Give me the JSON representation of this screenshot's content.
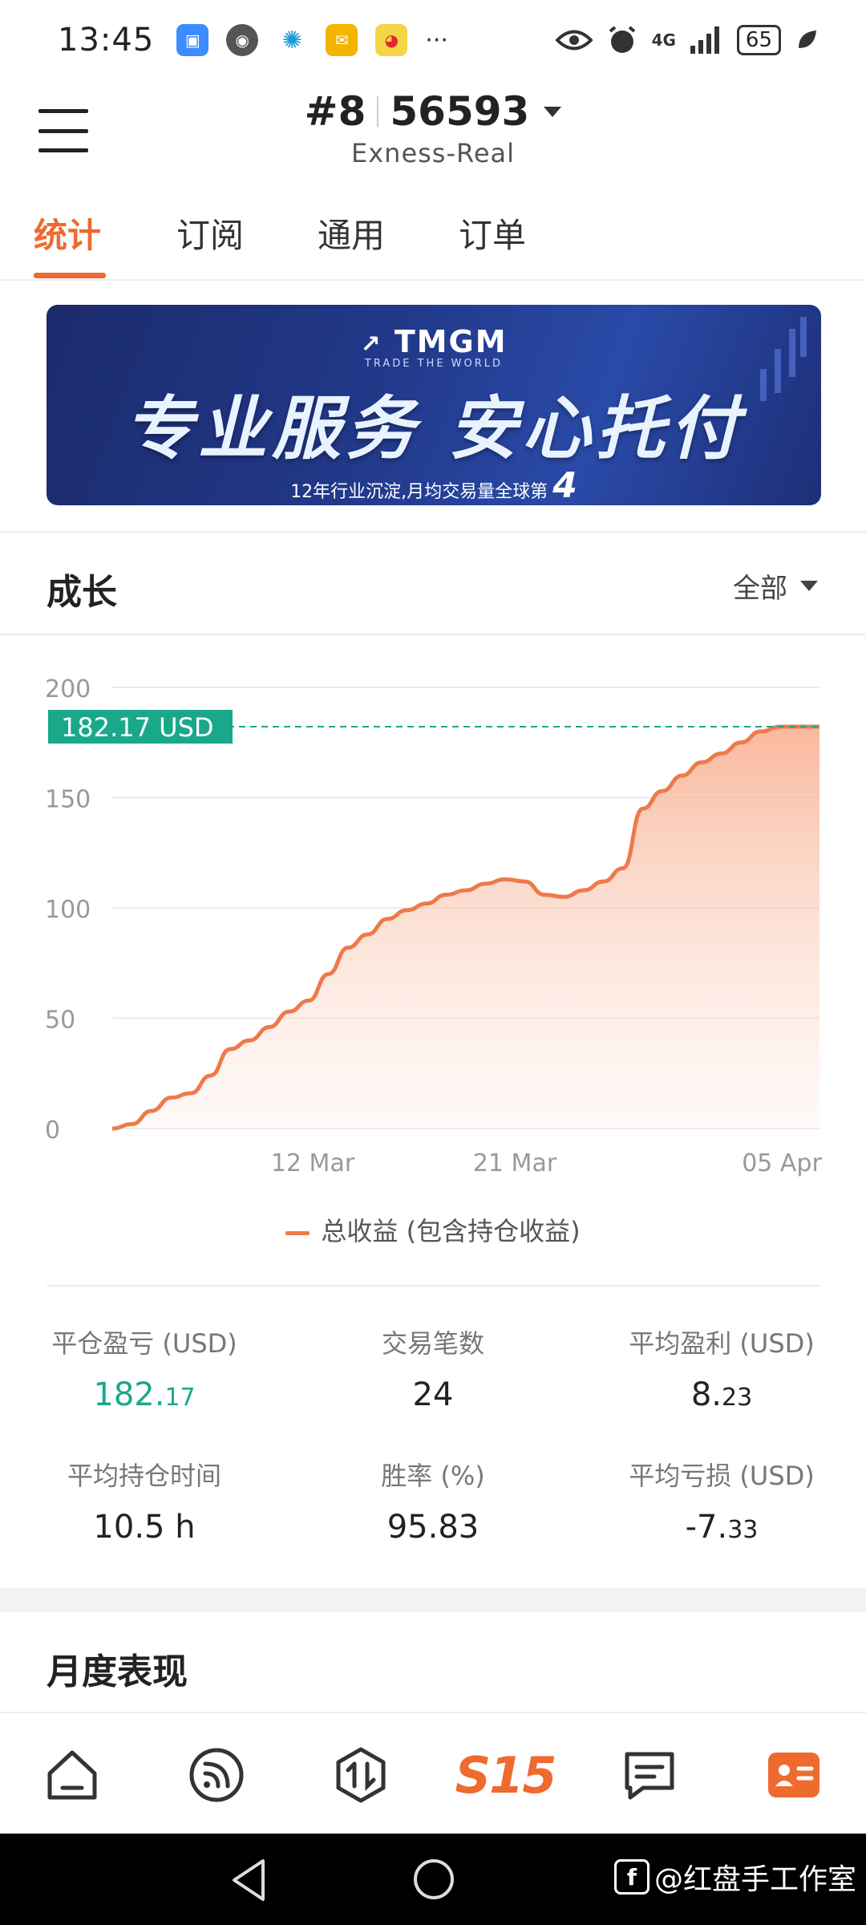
{
  "status_bar": {
    "time": "13:45",
    "network": "4G",
    "battery": "65",
    "more": "···"
  },
  "header": {
    "account_prefix": "#8",
    "account_number": "56593",
    "server": "Exness-Real"
  },
  "tabs": [
    {
      "label": "统计",
      "active": true
    },
    {
      "label": "订阅",
      "active": false
    },
    {
      "label": "通用",
      "active": false
    },
    {
      "label": "订单",
      "active": false
    }
  ],
  "banner": {
    "logo": "TMGM",
    "tagline": "TRADE THE WORLD",
    "title": "专业服务 安心托付",
    "footer_text": "12年行业沉淀,月均交易量全球第",
    "footer_rank": "4"
  },
  "growth": {
    "title": "成长",
    "filter": "全部"
  },
  "chart_data": {
    "type": "area",
    "y_ticks": [
      "200",
      "150",
      "100",
      "50",
      "0"
    ],
    "ylim": [
      0,
      200
    ],
    "x_ticks": [
      "12 Mar",
      "21 Mar",
      "05 Apr"
    ],
    "current_label": "182.17 USD",
    "current_value": 182.17,
    "grid": true,
    "series": [
      {
        "name": "总收益 (包含持仓收益)",
        "color": "#ee7a4a",
        "values": [
          0,
          2,
          8,
          14,
          16,
          24,
          36,
          40,
          46,
          53,
          58,
          70,
          82,
          88,
          95,
          99,
          102,
          106,
          108,
          111,
          113,
          112,
          106,
          105,
          108,
          112,
          118,
          145,
          153,
          160,
          166,
          170,
          175,
          180,
          182.17,
          182.17,
          182.17
        ]
      }
    ]
  },
  "stats": {
    "closed_pnl": {
      "label": "平仓盈亏 (USD)",
      "int": "182.",
      "frac": "17"
    },
    "trades": {
      "label": "交易笔数",
      "value": "24"
    },
    "avg_profit": {
      "label": "平均盈利 (USD)",
      "int": "8.",
      "frac": "23"
    },
    "avg_hold": {
      "label": "平均持仓时间",
      "value": "10.5 h"
    },
    "win_rate": {
      "label": "胜率 (%)",
      "value": "95.83"
    },
    "avg_loss": {
      "label": "平均亏损 (USD)",
      "int": "-7.",
      "frac": "33"
    }
  },
  "monthly": {
    "title": "月度表现"
  },
  "bottom_nav": {
    "items": [
      "home-icon",
      "feed-icon",
      "trade-icon",
      "s15-logo",
      "chat-icon",
      "profile-icon"
    ],
    "s15_label": "S15",
    "active_color": "#ee6a2e"
  },
  "watermark": {
    "text": "@红盘手工作室"
  }
}
